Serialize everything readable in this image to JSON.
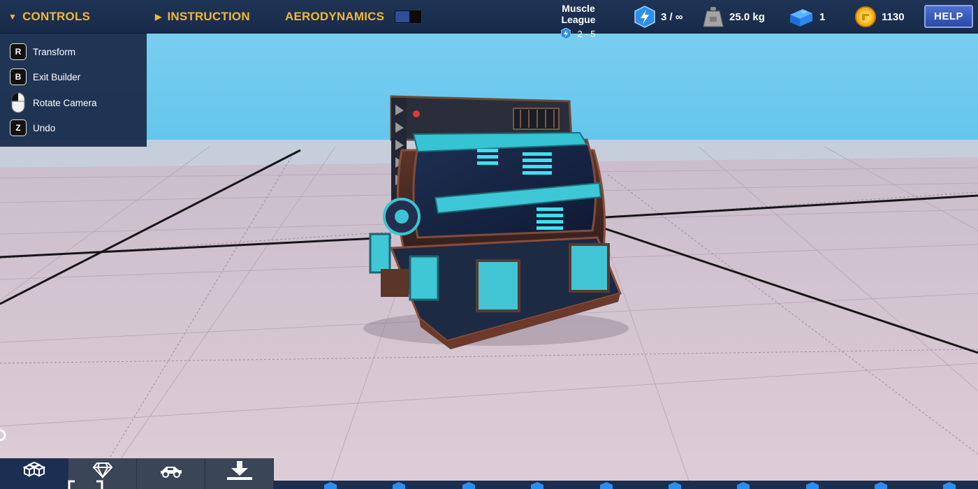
{
  "colors": {
    "accent": "#f2b833",
    "topbar": "#1f3456",
    "panel": "#1b2c4a",
    "help_button": "#3558bd",
    "sky": "#7fd3f3",
    "floor": "#d8c8d2",
    "vehicle_glow": "#37d7e8"
  },
  "topbar": {
    "controls_label": "CONTROLS",
    "instruction_label": "INSTRUCTION",
    "aerodynamics_label": "AERODYNAMICS",
    "aerodynamics_enabled": false,
    "league": {
      "name": "Muscle League",
      "tier": "2 - 5",
      "icon": "lightning-icon"
    },
    "stats": {
      "energy": {
        "icon": "lightning-icon",
        "value": "3 / ∞"
      },
      "weight": {
        "icon": "weight-icon",
        "value": "25.0 kg"
      },
      "blocks": {
        "icon": "cube-icon",
        "value": "1"
      },
      "coins": {
        "icon": "coin-icon",
        "value": "1130"
      }
    },
    "help_label": "HELP"
  },
  "controls_panel": {
    "items": [
      {
        "key": "R",
        "label": "Transform"
      },
      {
        "key": "B",
        "label": "Exit Builder"
      },
      {
        "key": "mouse-icon",
        "label": "Rotate Camera"
      },
      {
        "key": "Z",
        "label": "Undo"
      }
    ]
  },
  "bottom_tabs": [
    {
      "name": "blocks-tab",
      "icon": "blocks-icon",
      "active": true
    },
    {
      "name": "gems-tab",
      "icon": "diamond-icon",
      "active": false
    },
    {
      "name": "vehicles-tab",
      "icon": "car-icon",
      "active": false
    },
    {
      "name": "download-tab",
      "icon": "download-icon",
      "active": false
    }
  ]
}
